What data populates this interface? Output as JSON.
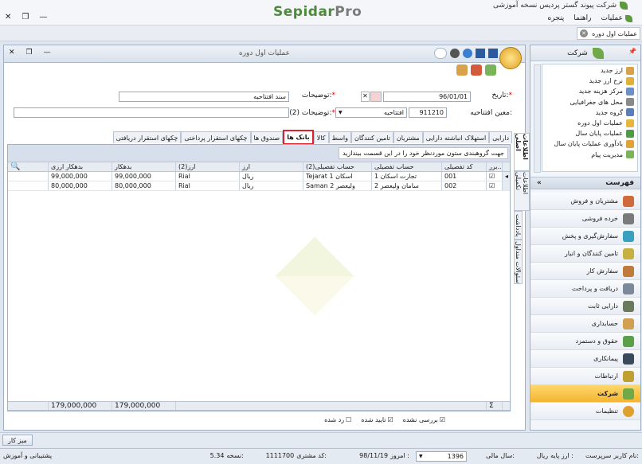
{
  "app": {
    "title": "شرکت پیوند گستر پردیس نسخه آموزشی",
    "logo_main": "Sepidar",
    "logo_sub": "Pro",
    "menu": [
      "عملیات",
      "راهنما",
      "پنجره"
    ],
    "doc_tab": "عملیات اول دوره"
  },
  "form": {
    "title": "عملیات اول دوره",
    "date_label": "تاریخ:",
    "date_value": "96/01/01",
    "desc_label": "توضیحات:",
    "desc_value": "سند افتتاحیه",
    "opening_label": "معین افتتاحیه:",
    "opening_code": "911210",
    "opening_name": "افتتاحیه",
    "desc2_label": "توضیحات (2):",
    "desc2_value": "",
    "star": "*",
    "side_tabs": [
      "اطلاعات اصلی",
      "اطلاعات تکمیلی",
      "یادداشت",
      "سئوالات متداول"
    ],
    "tabs": [
      "دارایی",
      "استهلاک انباشته دارایی",
      "مشتریان",
      "تامین کنندگان",
      "واسط",
      "کالا",
      "بانک ها",
      "صندوق ها",
      "چکهای استقرار پرداختی",
      "چکهای استقرار دریافتی"
    ],
    "group_hint": "جهت گروهبندی ستون موردنظر خود را در این قسمت بیندازید"
  },
  "grid": {
    "headers": [
      "برر...",
      "کد تفصیلی",
      "حساب تفصیلی",
      "حساب تفصیلی(2)",
      "ارز",
      "ارز(2)",
      "بدهکار",
      "بدهکار ارزی"
    ],
    "rows": [
      {
        "code": "001",
        "account": "تجارت اسکان 1",
        "account2": "Tejarat اسکان 1",
        "currency": "ریال",
        "currency2": "Rial",
        "debit": "99,000,000",
        "debit_fx": "99,000,000"
      },
      {
        "code": "002",
        "account": "سامان ولیعصر 2",
        "account2": "Saman ولیعصر 2",
        "currency": "ریال",
        "currency2": "Rial",
        "debit": "80,000,000",
        "debit_fx": "80,000,000"
      }
    ],
    "total_debit": "179,000,000",
    "total_debit_fx": "179,000,000",
    "sigma": "Σ"
  },
  "checks": {
    "unchecked": "بررسی نشده",
    "confirmed": "تایید شده",
    "rejected": "رد شده"
  },
  "sidebar": {
    "section_title": "شرکت",
    "sub_items": [
      "ارز جدید",
      "نرخ ارز جدید",
      "مرکز هزینه جدید",
      "محل های جغرافیایی",
      "گروه جدید",
      "عملیات اول دوره",
      "عملیات پایان سال",
      "یادآوری عملیات پایان سال",
      "مدیریت پیام"
    ],
    "list_title": "فهرست",
    "nav": [
      "مشتریان و فروش",
      "خرده فروشی",
      "سفارش‌گیری و پخش",
      "تامین کنندگان و انبار",
      "سفارش کار",
      "دریافت و پرداخت",
      "دارایی ثابت",
      "حسابداری",
      "حقوق و دستمزد",
      "پیمانکاری",
      "ارتباطات",
      "شرکت",
      "تنظیمات"
    ]
  },
  "bottom": {
    "desk_button": "میز کار"
  },
  "status": {
    "username_label": "نام کاربر:",
    "username": "سرپرست",
    "base_currency_label": "ارز پایه :",
    "base_currency": "ریال",
    "fiscal_year_label": "سال مالی:",
    "fiscal_year": "1396",
    "today_label": "امروز :",
    "today": "98/11/19",
    "customer_code_label": "کد مشتری:",
    "customer_code": "1111700",
    "version_label": "نسخه:",
    "version": "5.34",
    "support": "پشتیبانی و آموزش"
  },
  "colors": {
    "accent": "#f4b533",
    "highlight": "#e0202a",
    "logo": "#4d8a3a"
  }
}
